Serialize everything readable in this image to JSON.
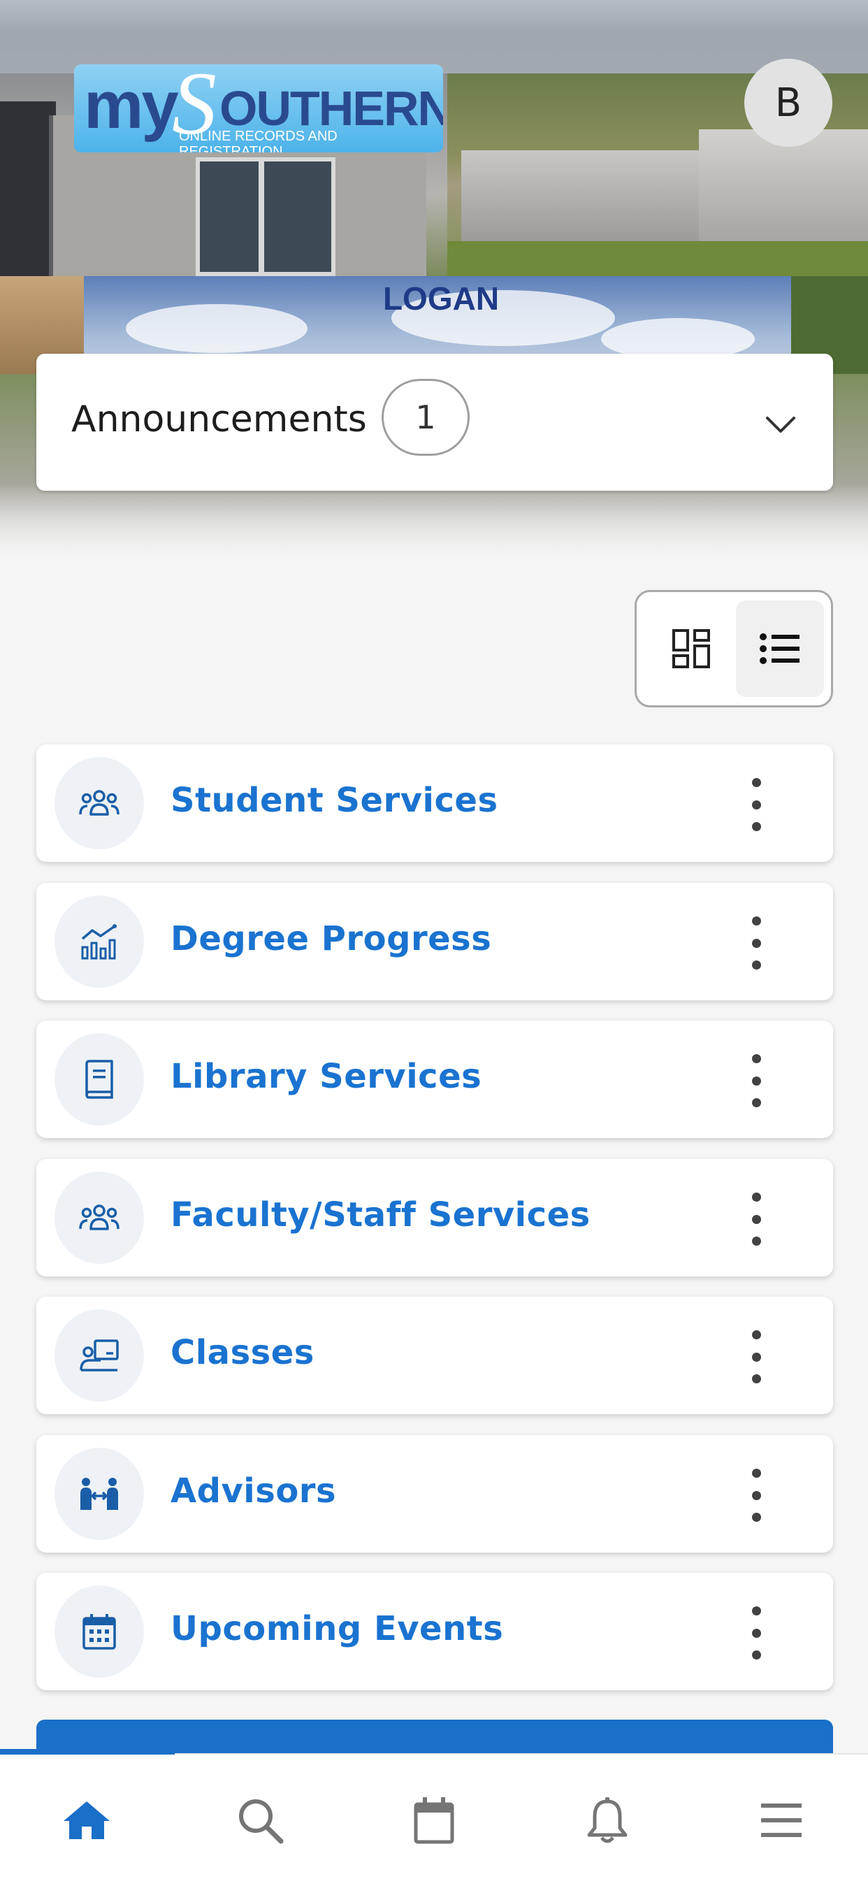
{
  "header": {
    "logo": {
      "my": "my",
      "brand_initial": "S",
      "brand_rest": "OUTHERN",
      "subtitle": "ONLINE RECORDS AND REGISTRATION"
    },
    "campus_name": "LOGAN",
    "avatar_initial": "B"
  },
  "announcements": {
    "label": "Announcements",
    "count": "1",
    "icon": "chevron-down-icon"
  },
  "view_toggle": {
    "options": [
      {
        "name": "card-view",
        "icon": "dashboard-icon",
        "selected": false
      },
      {
        "name": "list-view",
        "icon": "list-icon",
        "selected": true
      }
    ]
  },
  "cards": [
    {
      "title": "Student Services",
      "icon": "people-group-icon"
    },
    {
      "title": "Degree Progress",
      "icon": "chart-progress-icon"
    },
    {
      "title": "Library Services",
      "icon": "book-icon"
    },
    {
      "title": "Faculty/Staff Services",
      "icon": "people-group-icon"
    },
    {
      "title": "Classes",
      "icon": "classroom-icon"
    },
    {
      "title": "Advisors",
      "icon": "advisor-icon"
    },
    {
      "title": "Upcoming Events",
      "icon": "calendar-icon"
    }
  ],
  "bottom_nav": [
    {
      "name": "home",
      "icon": "home-icon",
      "active": true
    },
    {
      "name": "search",
      "icon": "search-icon",
      "active": false
    },
    {
      "name": "calendar",
      "icon": "calendar-icon",
      "active": false
    },
    {
      "name": "notifications",
      "icon": "bell-icon",
      "active": false
    },
    {
      "name": "menu",
      "icon": "menu-icon",
      "active": false
    }
  ],
  "colors": {
    "accent": "#1a73d0",
    "nav_active": "#1a6fc8",
    "nav_inactive": "#757575",
    "icon_bg": "#eef2f6"
  }
}
